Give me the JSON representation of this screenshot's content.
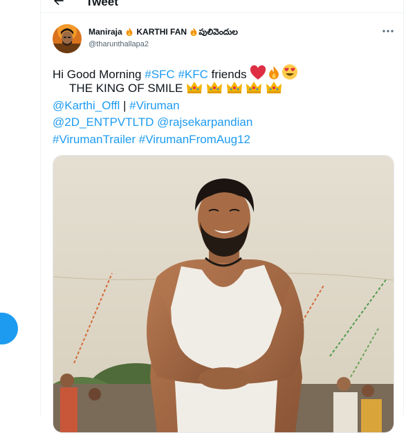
{
  "header": {
    "title": "Tweet"
  },
  "tweet": {
    "display_name": "Maniraja",
    "display_tag_1": "KARTHI FAN",
    "display_tag_2": "పులివెందుల",
    "handle": "@tharunthallapa2",
    "text": {
      "greeting": "Hi Good Morning ",
      "hashtag_sfc": "#SFC",
      "hashtag_kfc": "#KFC",
      "friends": " friends ",
      "king_line": "THE KING OF SMILE ",
      "mention_karthi": "@Karthi_Offl",
      "separator": " | ",
      "hashtag_viruman": "#Viruman",
      "mention_2d": "@2D_ENTPVTLTD",
      "mention_rajsekar": "@rajsekarpandian",
      "hashtag_trailer": "#VirumanTrailer",
      "hashtag_fromaug": "#VirumanFromAug12"
    },
    "media_alt": "Image"
  },
  "icons": {
    "back": "back-arrow-icon",
    "more": "more-horizontal-icon",
    "fire": "fire-icon",
    "heart": "red-heart-icon",
    "heart_eyes": "heart-eyes-icon",
    "crown": "crown-icon"
  },
  "colors": {
    "link": "#1d9bf0",
    "text": "#0f1419",
    "muted": "#536471"
  }
}
